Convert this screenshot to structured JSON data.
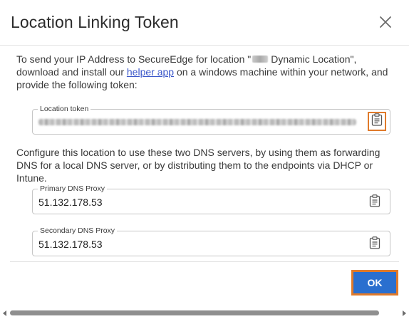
{
  "dialog": {
    "title": "Location Linking Token",
    "close_icon": "close-icon"
  },
  "content": {
    "intro_prefix": "To send your IP Address to SecureEdge for location \"",
    "intro_location": "Dynamic Location",
    "intro_middle": "\", download and install our ",
    "helper_link": "helper app",
    "intro_suffix": " on a windows machine within your network, and provide the following token:",
    "token_field": {
      "label": "Location token",
      "copy_icon": "clipboard-icon"
    },
    "dns_instructions": "Configure this location to use these two DNS servers, by using them as forwarding DNS for a local DNS server, or by distributing them to the endpoints via DHCP or Intune.",
    "primary_dns": {
      "label": "Primary DNS Proxy",
      "value": "51.132.178.53",
      "copy_icon": "clipboard-icon"
    },
    "secondary_dns": {
      "label": "Secondary DNS Proxy",
      "value": "51.132.178.53",
      "copy_icon": "clipboard-icon"
    }
  },
  "footer": {
    "ok_label": "OK"
  },
  "colors": {
    "accent": "#2a6fcf",
    "highlight": "#e07a2a",
    "link": "#3a56c9"
  }
}
